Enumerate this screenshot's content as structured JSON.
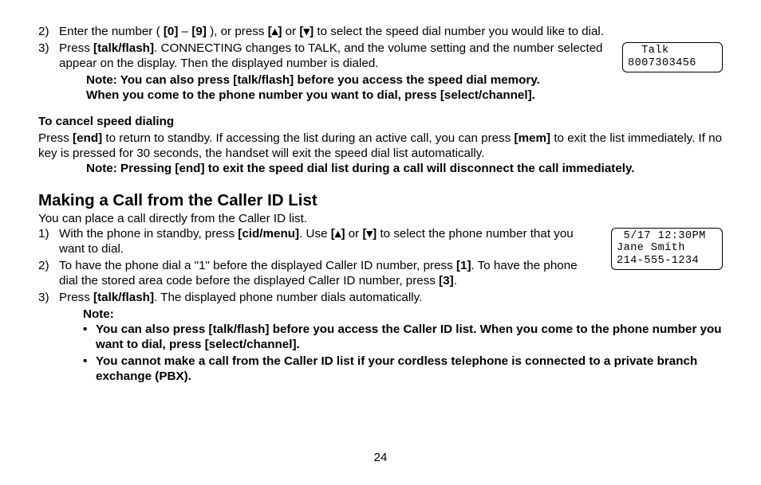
{
  "step2": {
    "num": "2)",
    "pre": "Enter the number ( ",
    "k0": "[0]",
    "dash": " – ",
    "k9": "[9]",
    "post1": " ), or press ",
    "kup": "[▴]",
    "or": " or ",
    "kdn": "[▾]",
    "post2": " to select the speed dial number you would like to dial."
  },
  "step3": {
    "num": "3)",
    "pre": "Press ",
    "k": "[talk/flash]",
    "post": ". CONNECTING changes to TALK, and the volume setting and the number selected appear on the display. Then the displayed number is dialed."
  },
  "display1": {
    "line1": "  Talk",
    "line2": "8007303456"
  },
  "note1a": "Note: You can also press [talk/flash] before you access the speed dial memory.",
  "note1b": "When you come to the phone number you want to dial, press [select/channel].",
  "cancel_head": "To cancel speed dialing",
  "cancel_body": {
    "t1": "Press ",
    "k1": "[end]",
    "t2": " to return to standby. If accessing the list during an active call, you can press ",
    "k2": "[mem]",
    "t3": " to exit the list immediately. If no key is pressed for 30 seconds, the handset will exit the speed dial list automatically."
  },
  "note2": "Note: Pressing [end] to exit the speed dial list during a call will disconnect the call immediately.",
  "h2": "Making a Call from the Caller ID List",
  "intro": "You can place a call directly from the Caller ID list.",
  "cid1": {
    "num": "1)",
    "t1": "With the phone in standby, press ",
    "k1": "[cid/menu]",
    "t2": ". Use ",
    "kup": "[▴]",
    "or": " or ",
    "kdn": "[▾]",
    "t3": " to select the phone number that you want to dial."
  },
  "cid2": {
    "num": "2)",
    "t1": "To have the phone dial a \"1\" before the displayed Caller ID number, press ",
    "k1": "[1]",
    "t2": ". To have the phone dial the stored area code before the displayed Caller ID number, press ",
    "k2": "[3]",
    "t3": "."
  },
  "cid3": {
    "num": "3)",
    "t1": "Press ",
    "k1": "[talk/flash]",
    "t2": ". The displayed phone number dials automatically."
  },
  "display2": {
    "line1": " 5/17 12:30PM",
    "line2": "Jane Smith",
    "line3": "214-555-1234"
  },
  "note_label": "Note:",
  "bullet_dot": "•",
  "bullet1": "You can also press [talk/flash] before you access the Caller ID list. When you come to the phone number you want to dial, press [select/channel].",
  "bullet2": "You cannot make a call from the Caller ID list if your cordless telephone is connected to a private branch exchange (PBX).",
  "page_num": "24"
}
